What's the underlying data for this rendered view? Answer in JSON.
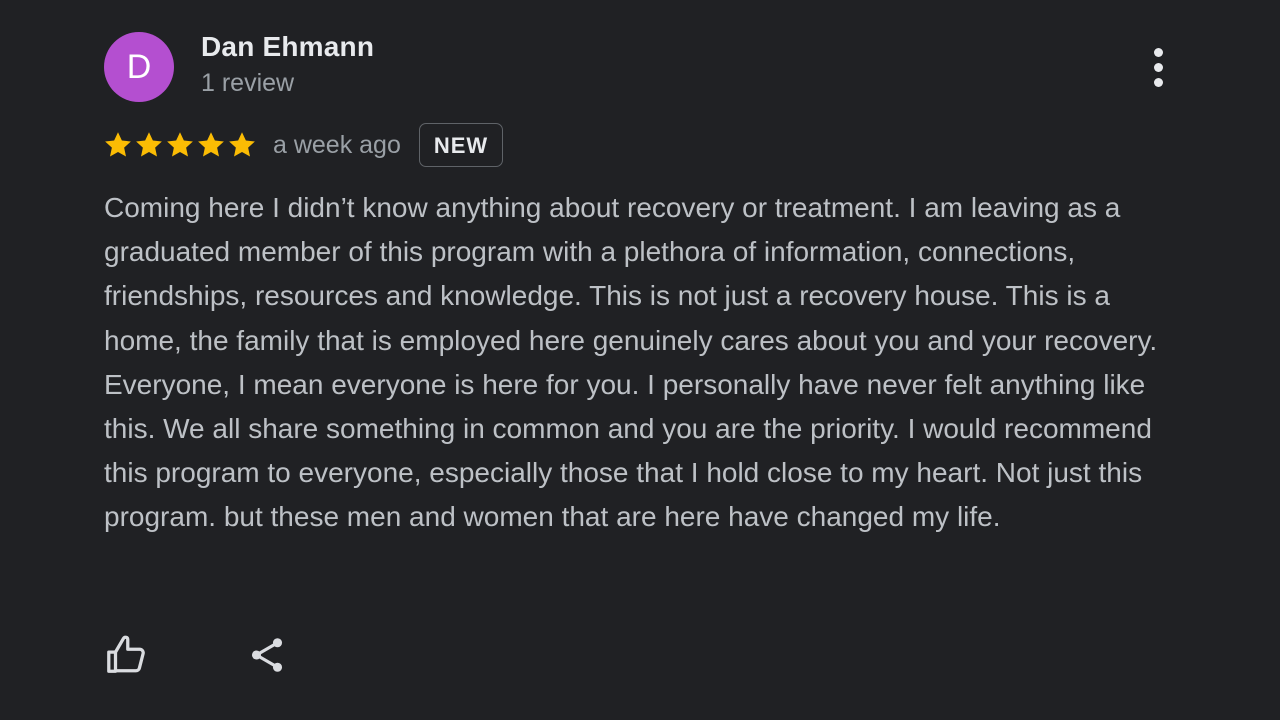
{
  "review": {
    "author": {
      "avatar_letter": "D",
      "avatar_color": "#b44fd0",
      "name": "Dan Ehmann",
      "meta": "1 review"
    },
    "rating": 5,
    "max_rating": 5,
    "star_color": "#fbbc04",
    "time": "a week ago",
    "badge": "NEW",
    "text": "Coming here I didn’t know anything about recovery or treatment. I am leaving as a graduated member of this program with a plethora of information, connections, friendships, resources and knowledge. This is not just a recovery house. This is a home, the family that is employed here genuinely cares about you and your recovery. Everyone, I mean everyone is here for you. I personally have never felt anything like this. We all share something in common and you are the priority. I would recommend this program to everyone, especially those that I hold close to my heart. Not just this program. but these men and women that are here have changed my life."
  },
  "icons": {
    "more": "more-vert-icon",
    "like": "thumbs-up-icon",
    "share": "share-icon"
  }
}
